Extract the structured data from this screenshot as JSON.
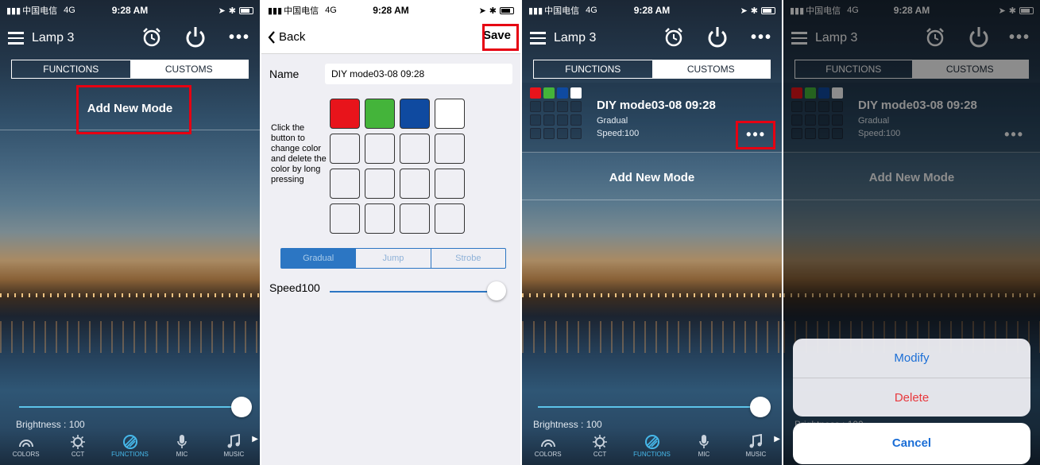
{
  "status": {
    "carrier": "中国电信",
    "network": "4G",
    "time": "9:28 AM"
  },
  "lamp": {
    "title": "Lamp 3",
    "more": "•••",
    "segment": {
      "functions": "FUNCTIONS",
      "customs": "CUSTOMS"
    },
    "add_new_mode": "Add New Mode",
    "brightness_label": "Brightness : 100",
    "brightness_level": 100,
    "tabs": [
      "COLORS",
      "CCT",
      "FUNCTIONS",
      "MIC",
      "MUSIC"
    ]
  },
  "editor": {
    "back_label": "Back",
    "save_label": "Save",
    "name_label": "Name",
    "name_value": "DIY mode03-08 09:28",
    "hint": "Click the button to change color and delete the color by long pressing",
    "colors": [
      "#e8141b",
      "#44b43a",
      "#0f4aa0",
      "#ffffff"
    ],
    "modes": [
      "Gradual",
      "Jump",
      "Strobe"
    ],
    "selected_mode": "Gradual",
    "speed_label": "Speed100",
    "speed_level": 100
  },
  "custom_entry": {
    "title": "DIY mode03-08 09:28",
    "mode": "Gradual",
    "speed": "Speed:100",
    "colors": [
      "#e8141b",
      "#44b43a",
      "#0f4aa0",
      "#ffffff"
    ]
  },
  "action_sheet": {
    "modify": "Modify",
    "delete": "Delete",
    "cancel": "Cancel"
  },
  "palette": {
    "accent": "#46b8ea",
    "highlight": "#e60012",
    "ios_blue": "#1b6ed6",
    "ios_red": "#e8383d"
  }
}
